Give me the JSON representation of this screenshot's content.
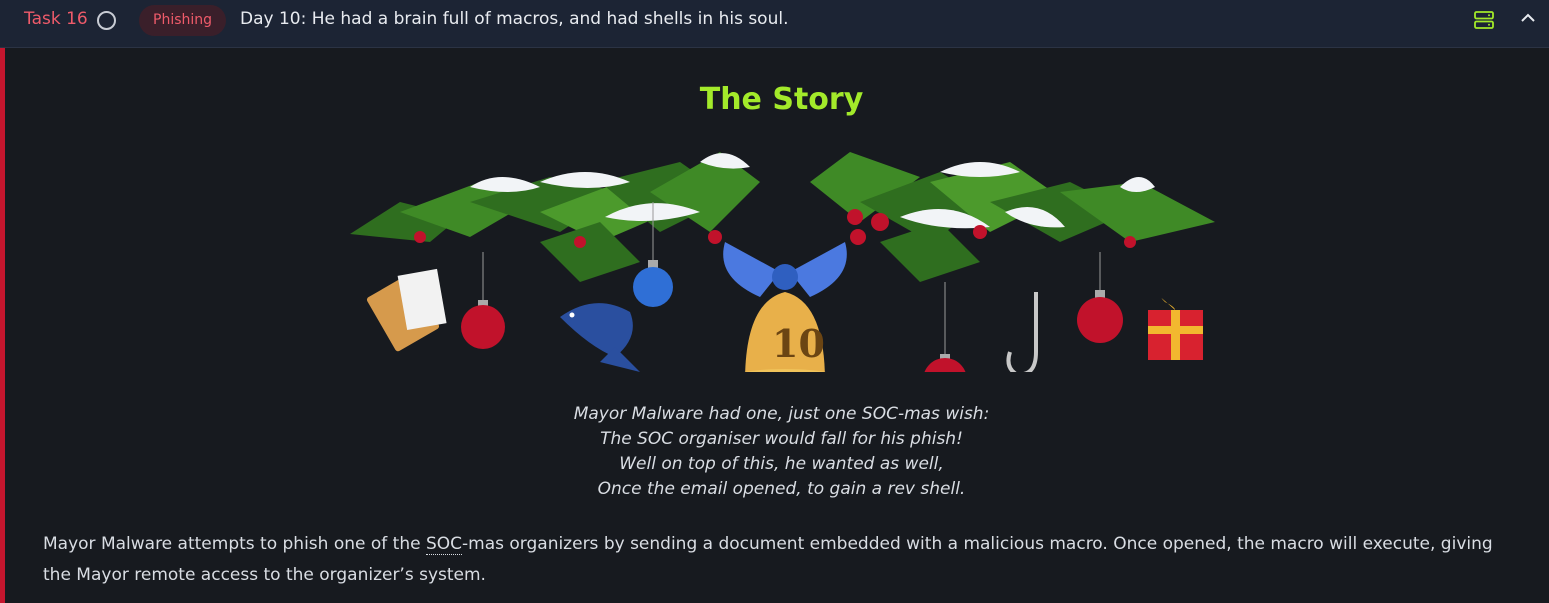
{
  "header": {
    "task_label": "Task 16",
    "tag_label": "Phishing",
    "title": "Day 10: He had a brain full of macros, and had shells in his soul.",
    "icons": {
      "status": "circle-icon",
      "view": "server-icon",
      "collapse": "chevron-up-icon"
    }
  },
  "story": {
    "heading": "The Story",
    "banner_icons": [
      "holly-garland",
      "clipboard-icon",
      "ornament-red",
      "fish-icon",
      "ornament-blue",
      "bow-icon",
      "bell-icon",
      "hook-icon",
      "gift-icon"
    ],
    "bell_number": "10",
    "poem": [
      "Mayor Malware had one, just one SOC-mas wish:",
      "The SOC organiser would fall for his phish!",
      "Well on top of this, he wanted as well,",
      "Once the email opened, to gain a rev shell."
    ],
    "paragraph_prefix": "Mayor Malware attempts to phish one of the ",
    "paragraph_abbr": "SOC",
    "paragraph_suffix": "-mas organizers by sending a document embedded with a malicious macro. Once opened, the macro will execute, giving the Mayor remote access to the organizer’s system."
  },
  "colors": {
    "accent": "#c5162e",
    "heading": "#a3ea2a",
    "task_label": "#ef5b6a",
    "header_bg": "#1c2434",
    "content_bg": "#171a1f"
  }
}
